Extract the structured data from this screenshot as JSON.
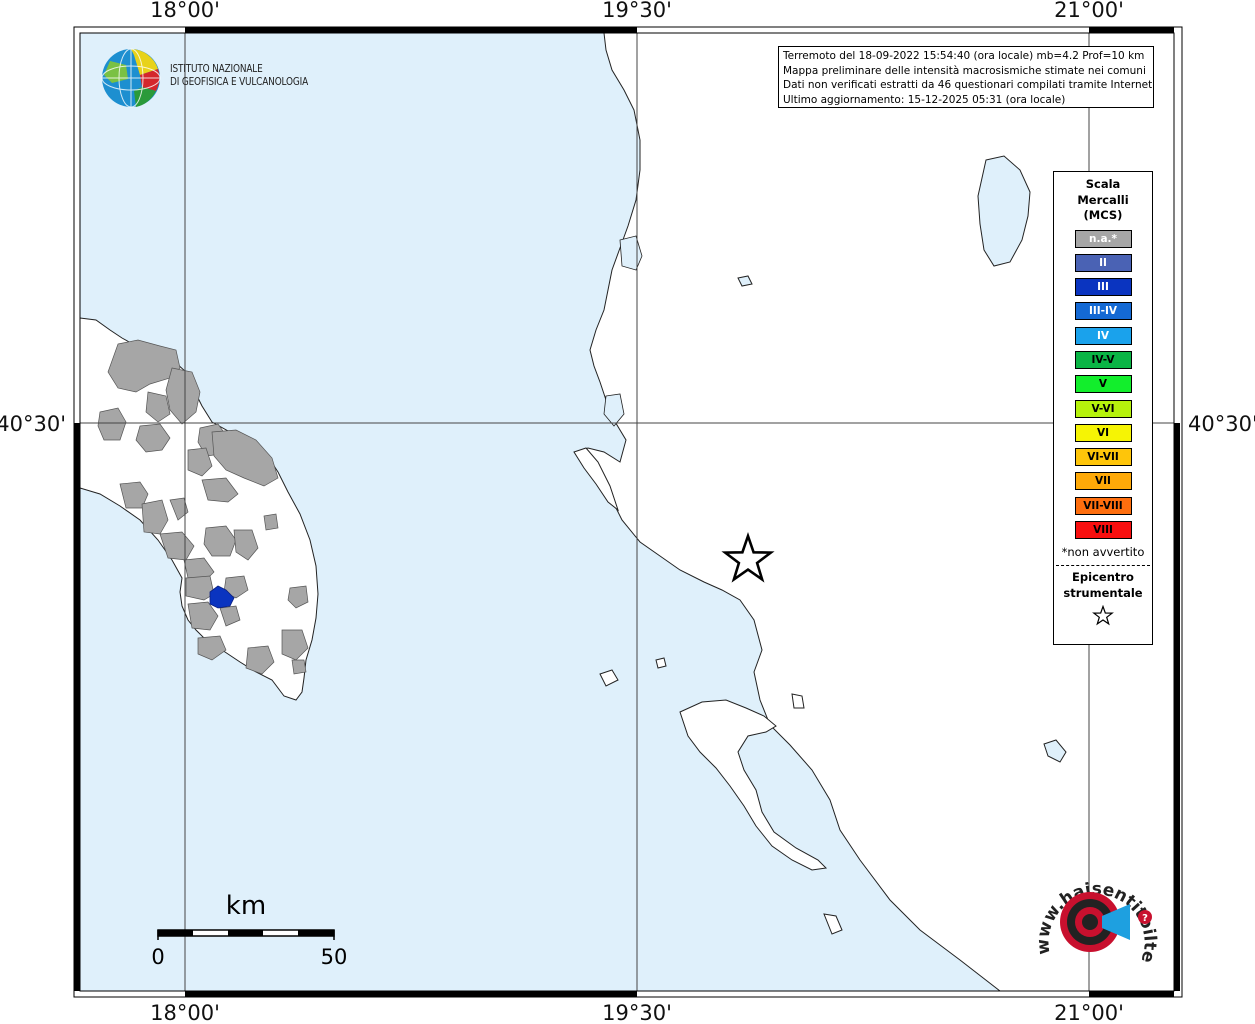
{
  "map": {
    "lon_labels": [
      "18°00'",
      "19°30'",
      "21°00'"
    ],
    "lat_label": "40°30'",
    "colors": {
      "sea": "#dff0fb",
      "land": "#ffffff",
      "felt_not_available": "#a6a6a6",
      "intensity_III": "#0a34c0"
    }
  },
  "info_box": {
    "line1": "Terremoto del 18-09-2022 15:54:40 (ora locale) mb=4.2 Prof=10 km",
    "line2": "Mappa preliminare delle intensità macrosismiche stimate nei comuni",
    "line3": "Dati non verificati estratti da 46 questionari compilati tramite Internet.",
    "line4": "Ultimo aggiornamento: 15-12-2025 05:31 (ora locale)"
  },
  "logo": {
    "line1": "ISTITUTO NAZIONALE",
    "line2": "DI GEOFISICA E VULCANOLOGIA"
  },
  "legend": {
    "title": [
      "Scala",
      "Mercalli",
      "(MCS)"
    ],
    "items": [
      {
        "label": "n.a.*",
        "color": "#a6a6a6",
        "text_color": "#ffffff"
      },
      {
        "label": "II",
        "color": "#4a62b4",
        "text_color": "#ffffff"
      },
      {
        "label": "III",
        "color": "#0a34c0",
        "text_color": "#ffffff"
      },
      {
        "label": "III-IV",
        "color": "#1469d4",
        "text_color": "#ffffff"
      },
      {
        "label": "IV",
        "color": "#1aa2ec",
        "text_color": "#ffffff"
      },
      {
        "label": "IV-V",
        "color": "#0ab545",
        "text_color": "#000000"
      },
      {
        "label": "V",
        "color": "#12ee2c",
        "text_color": "#000000"
      },
      {
        "label": "V-VI",
        "color": "#b6f20c",
        "text_color": "#000000"
      },
      {
        "label": "VI",
        "color": "#f6f404",
        "text_color": "#000000"
      },
      {
        "label": "VI-VII",
        "color": "#fec50a",
        "text_color": "#000000"
      },
      {
        "label": "VII",
        "color": "#fea908",
        "text_color": "#000000"
      },
      {
        "label": "VII-VIII",
        "color": "#fe6e0e",
        "text_color": "#000000"
      },
      {
        "label": "VIII",
        "color": "#f80f0f",
        "text_color": "#000000"
      }
    ],
    "note": "*non avvertito",
    "epicenter": [
      "Epicentro",
      "strumentale"
    ]
  },
  "scale_bar": {
    "unit": "km",
    "min_label": "0",
    "max_label": "50"
  },
  "watermark": {
    "text": "www.haisentitoilterremoto.it"
  }
}
